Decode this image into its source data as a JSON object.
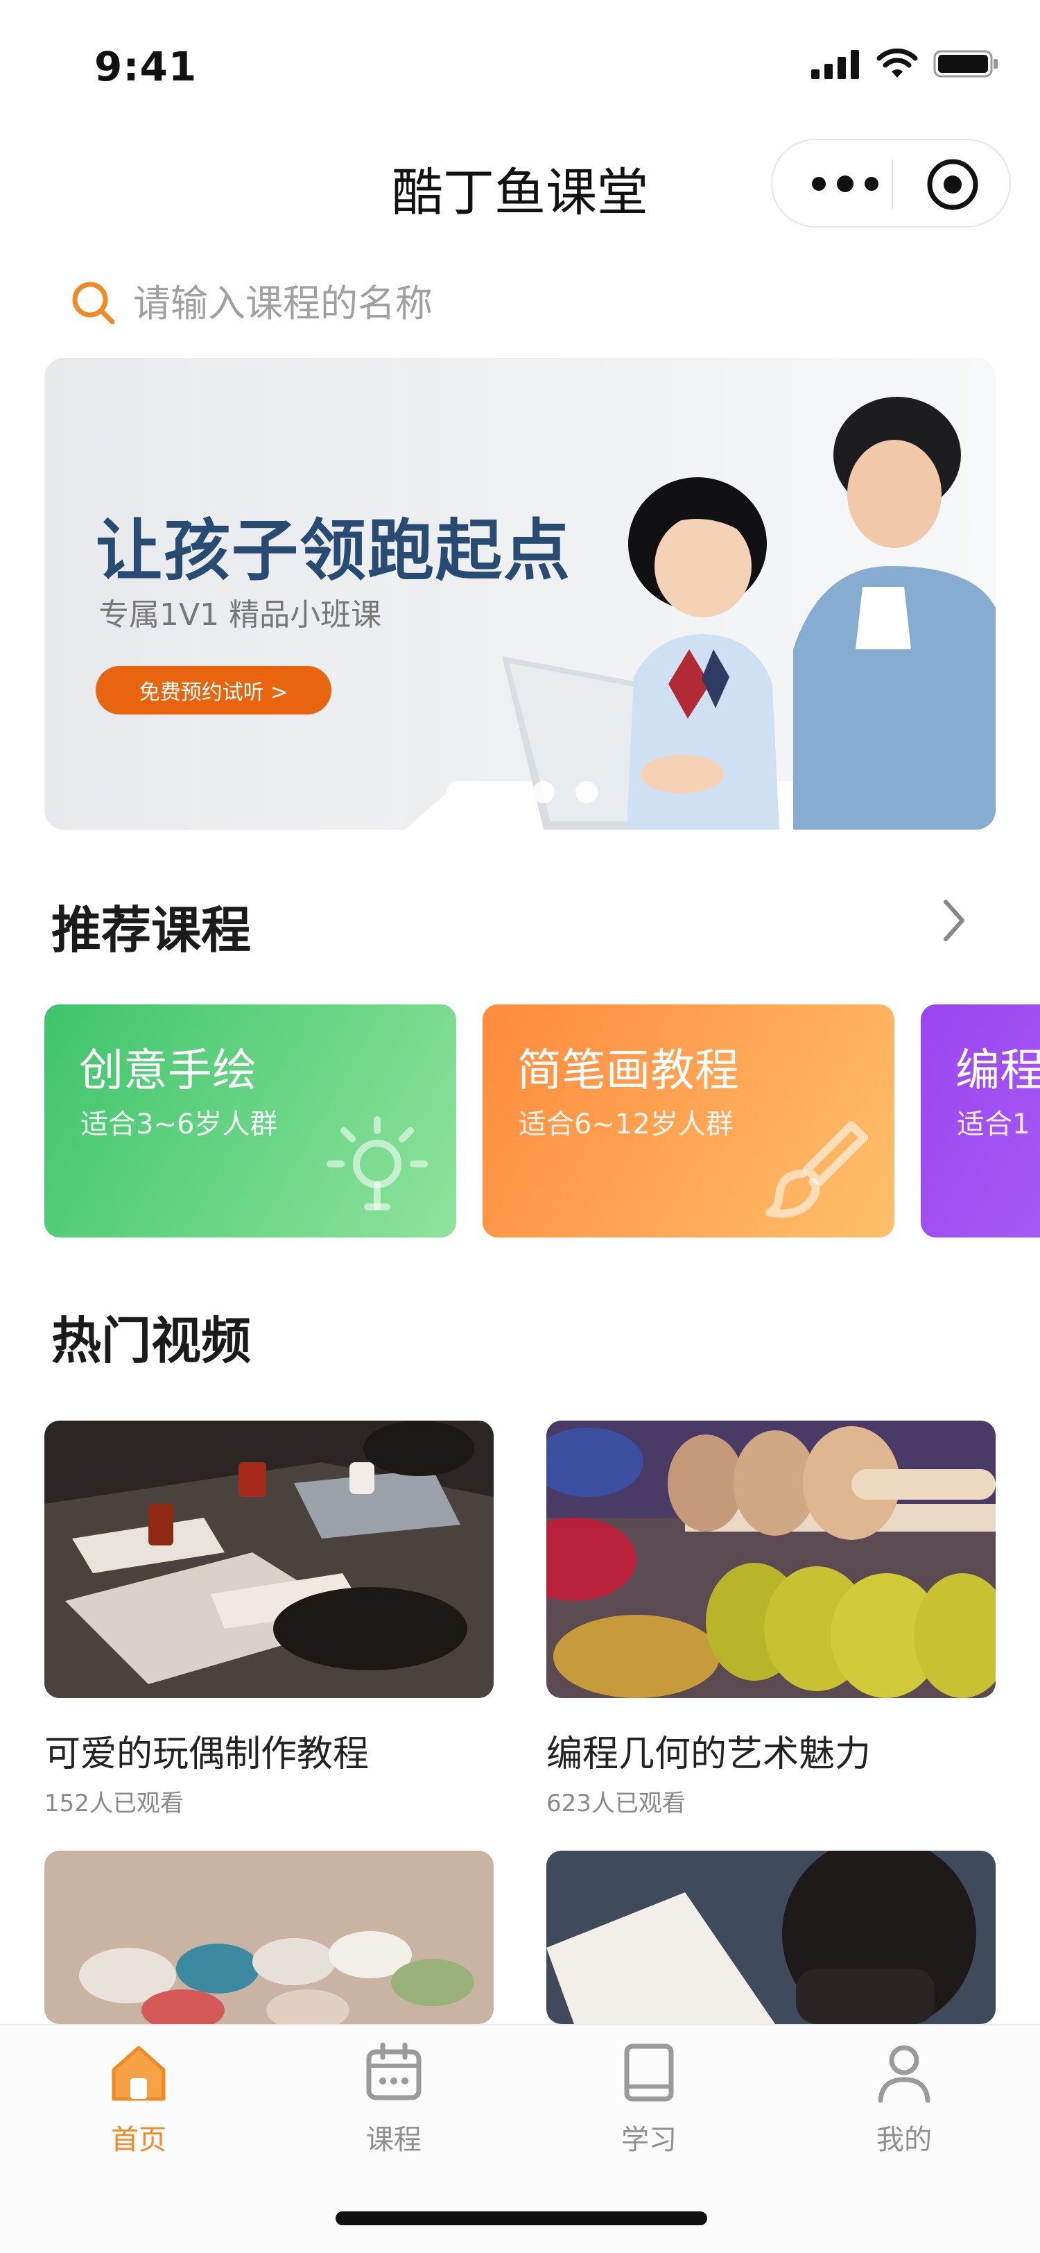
{
  "status_bar": {
    "time": "9:41"
  },
  "title_bar": {
    "title": "酷丁鱼课堂"
  },
  "search": {
    "placeholder": "请输入课程的名称"
  },
  "banner": {
    "title": "让孩子领跑起点",
    "subtitle": "专属1V1 精品小班课",
    "cta": "免费预约试听 >"
  },
  "recommended": {
    "title": "推荐课程",
    "cards": [
      {
        "title": "创意手绘",
        "subtitle": "适合3~6岁人群",
        "icon": "lightbulb-icon",
        "color_from": "#3ec46b",
        "color_to": "#8fe39c"
      },
      {
        "title": "简笔画教程",
        "subtitle": "适合6~12岁人群",
        "icon": "brush-icon",
        "color_from": "#ff8a3c",
        "color_to": "#ffbf6a"
      },
      {
        "title": "编程",
        "subtitle": "适合1",
        "icon": "",
        "color_from": "#9a45f0",
        "color_to": "#b470f6"
      }
    ]
  },
  "hot_videos": {
    "title": "热门视频",
    "items": [
      {
        "title": "可爱的玩偶制作教程",
        "views": "152人已观看"
      },
      {
        "title": "编程几何的艺术魅力",
        "views": "623人已观看"
      }
    ]
  },
  "tab_bar": {
    "items": [
      {
        "label": "首页",
        "icon": "home-icon",
        "active": true
      },
      {
        "label": "课程",
        "icon": "calendar-icon",
        "active": false
      },
      {
        "label": "学习",
        "icon": "book-icon",
        "active": false
      },
      {
        "label": "我的",
        "icon": "user-icon",
        "active": false
      }
    ]
  },
  "colors": {
    "accent": "#f08a24",
    "banner_button": "#e8640f",
    "banner_title": "#274b72"
  }
}
